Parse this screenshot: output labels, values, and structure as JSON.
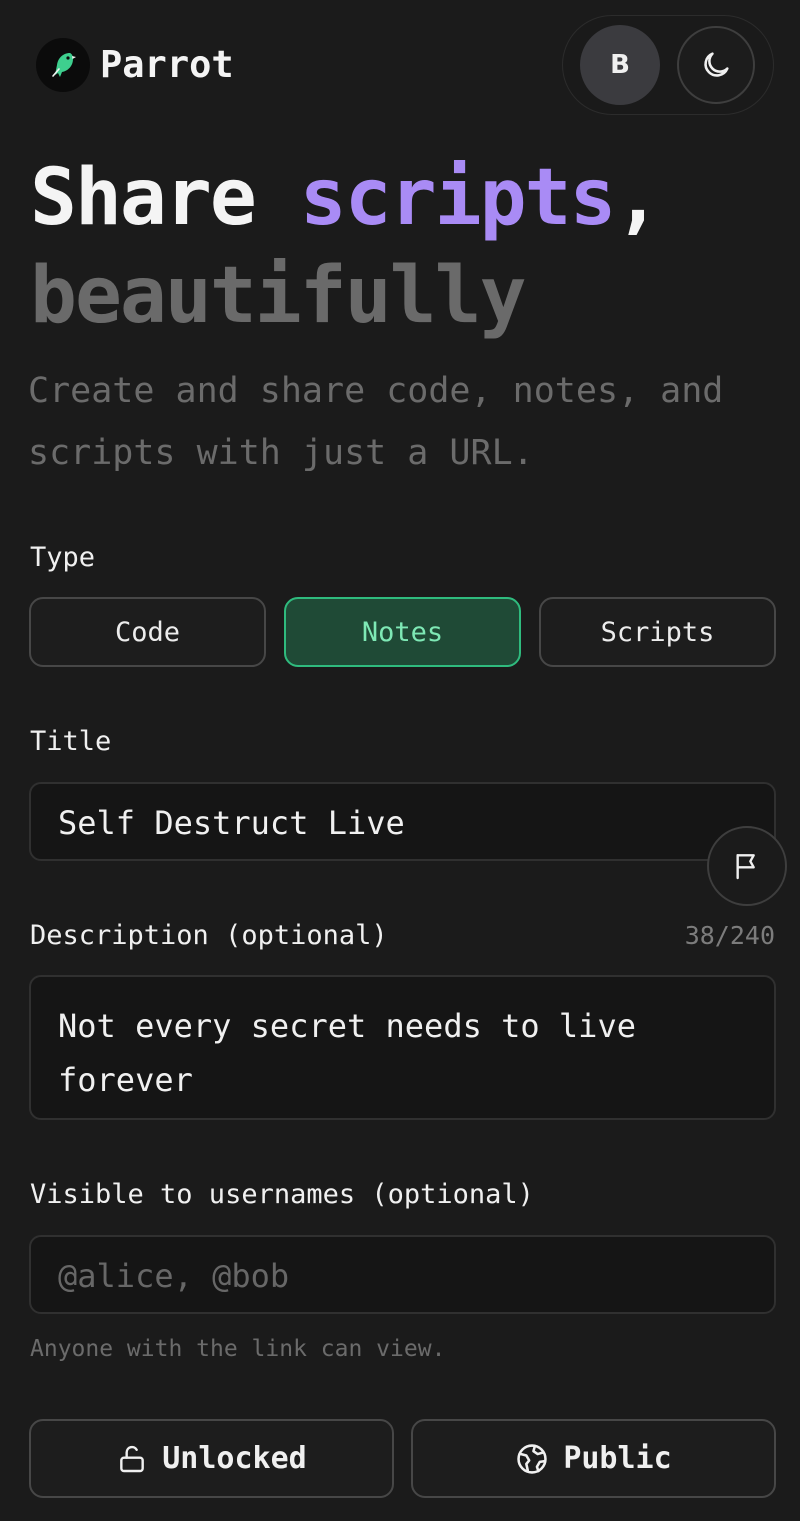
{
  "header": {
    "brand": "Parrot",
    "avatar_initial": "B"
  },
  "hero": {
    "title_part1": "Share ",
    "title_accent": "scripts",
    "title_comma": ",",
    "title_line2": "beautifully",
    "subtitle": "Create and share code, notes, and scripts with just a URL."
  },
  "type_section": {
    "label": "Type",
    "options": [
      "Code",
      "Notes",
      "Scripts"
    ],
    "selected": "Notes"
  },
  "title_section": {
    "label": "Title",
    "value": "Self Destruct Live"
  },
  "description_section": {
    "label": "Description (optional)",
    "counter": "38/240",
    "value": "Not every secret needs to live forever"
  },
  "visibility_section": {
    "label": "Visible to usernames (optional)",
    "placeholder": "@alice, @bob",
    "hint": "Anyone with the link can view."
  },
  "actions": {
    "lock_label": "Unlocked",
    "public_label": "Public"
  },
  "colors": {
    "background": "#1b1b1b",
    "accent_purple": "#a98bf5",
    "accent_green": "#2fbb7e",
    "logo_green": "#3ecf8e"
  }
}
